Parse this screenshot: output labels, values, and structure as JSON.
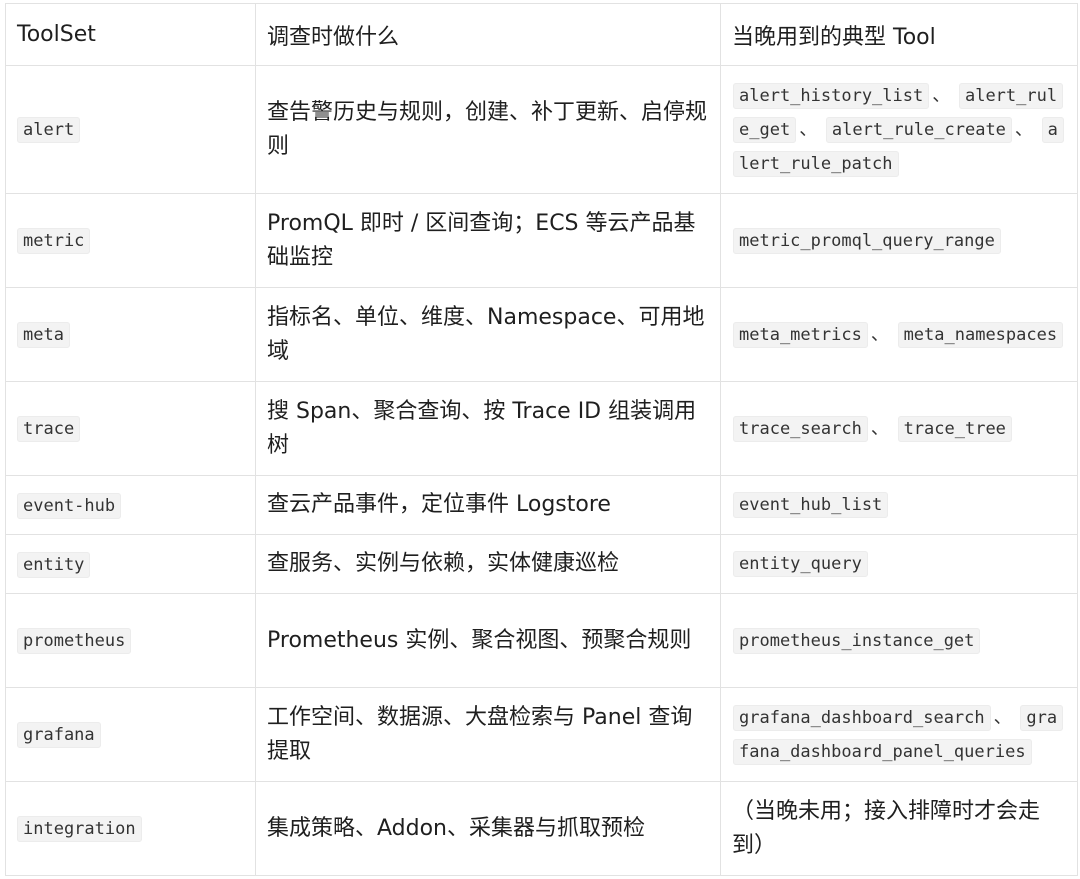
{
  "headers": [
    "ToolSet",
    "调查时做什么",
    "当晚用到的典型 Tool"
  ],
  "rows": [
    {
      "toolset": "alert",
      "desc": "查告警历史与规则，创建、补丁更新、启停规则",
      "tools": [
        "alert_history_list",
        "alert_rule_get",
        "alert_rule_create",
        "alert_rule_patch"
      ],
      "note": ""
    },
    {
      "toolset": "metric",
      "desc": "PromQL 即时 / 区间查询；ECS 等云产品基础监控",
      "tools": [
        "metric_promql_query_range"
      ],
      "note": ""
    },
    {
      "toolset": "meta",
      "desc": "指标名、单位、维度、Namespace、可用地域",
      "tools": [
        "meta_metrics",
        "meta_namespaces"
      ],
      "note": ""
    },
    {
      "toolset": "trace",
      "desc": "搜 Span、聚合查询、按 Trace ID 组装调用树",
      "tools": [
        "trace_search",
        "trace_tree"
      ],
      "note": ""
    },
    {
      "toolset": "event-hub",
      "desc": "查云产品事件，定位事件 Logstore",
      "tools": [
        "event_hub_list"
      ],
      "note": ""
    },
    {
      "toolset": "entity",
      "desc": "查服务、实例与依赖，实体健康巡检",
      "tools": [
        "entity_query"
      ],
      "note": ""
    },
    {
      "toolset": "prometheus",
      "desc": "Prometheus 实例、聚合视图、预聚合规则",
      "tools": [
        "prometheus_instance_get"
      ],
      "note": ""
    },
    {
      "toolset": "grafana",
      "desc": "工作空间、数据源、大盘检索与 Panel 查询提取",
      "tools": [
        "grafana_dashboard_search",
        "grafana_dashboard_panel_queries"
      ],
      "note": ""
    },
    {
      "toolset": "integration",
      "desc": "集成策略、Addon、采集器与抓取预检",
      "tools": [],
      "note": "（当晚未用；接入排障时才会走到）"
    }
  ]
}
